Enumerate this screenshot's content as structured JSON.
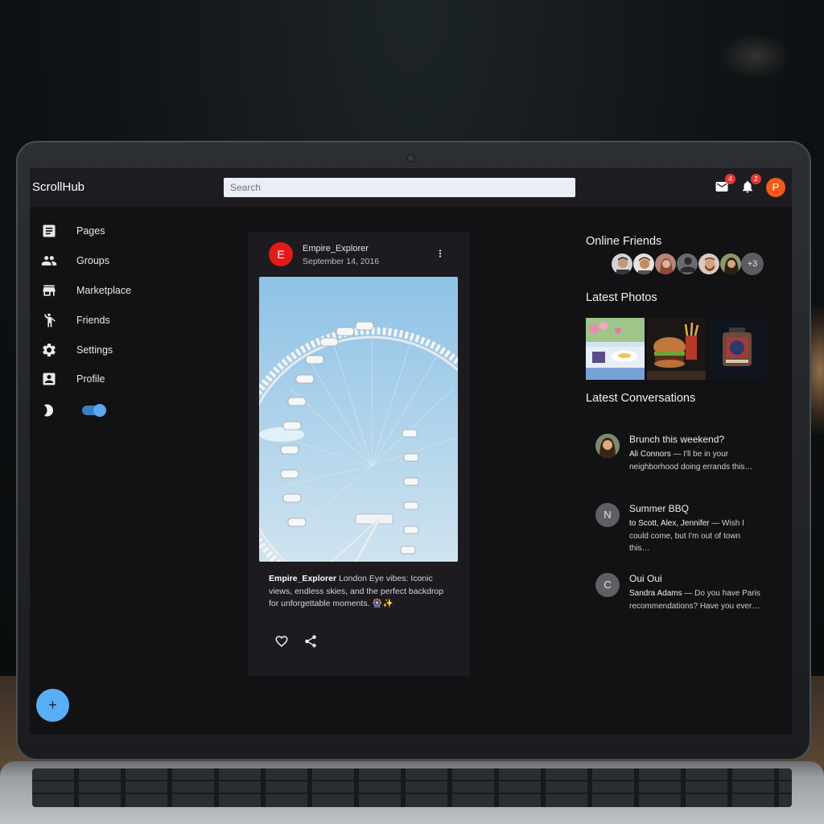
{
  "app": {
    "name": "ScrollHub"
  },
  "header": {
    "search_placeholder": "Search",
    "mail_badge": "4",
    "notifications_badge": "2",
    "profile_initial": "P"
  },
  "sidebar": {
    "items": [
      {
        "label": "Pages",
        "icon": "pages-icon"
      },
      {
        "label": "Groups",
        "icon": "groups-icon"
      },
      {
        "label": "Marketplace",
        "icon": "storefront-icon"
      },
      {
        "label": "Friends",
        "icon": "person-icon"
      },
      {
        "label": "Settings",
        "icon": "gear-icon"
      },
      {
        "label": "Profile",
        "icon": "profile-card-icon"
      }
    ],
    "dark_mode_on": true,
    "fab_label": "+"
  },
  "post": {
    "avatar_initial": "E",
    "username": "Empire_Explorer",
    "date": "September 14, 2016",
    "caption_user": "Empire_Explorer",
    "caption_text": "London Eye vibes: Iconic views, endless skies, and the perfect backdrop for unforgettable moments. 🎡✨"
  },
  "online_friends": {
    "title": "Online Friends",
    "more_count": "+3"
  },
  "latest_photos": {
    "title": "Latest Photos"
  },
  "conversations": {
    "title": "Latest Conversations",
    "items": [
      {
        "initial": "",
        "title": "Brunch this weekend?",
        "from": "Ali Connors",
        "text": " — I'll be in your neighborhood doing errands this…"
      },
      {
        "initial": "N",
        "title": "Summer BBQ",
        "from": "to Scott, Alex, Jennifer",
        "text": " — Wish I could come, but I'm out of town this…"
      },
      {
        "initial": "C",
        "title": "Oui Oui",
        "from": "Sandra Adams",
        "text": " — Do you have Paris recommendations? Have you ever…"
      }
    ]
  },
  "colors": {
    "accent": "#5aaef5",
    "badge": "#e53935",
    "post_avatar": "#e21a1a",
    "profile_avatar": "#f05a1a"
  }
}
